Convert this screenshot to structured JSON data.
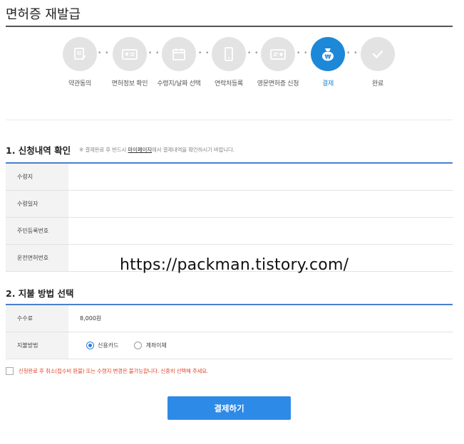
{
  "page": {
    "title": "면허증 재발급"
  },
  "steps": [
    {
      "label": "약관동의",
      "icon": "document-pen-icon",
      "active": false
    },
    {
      "label": "면허정보 확인",
      "icon": "id-card-icon",
      "active": false
    },
    {
      "label": "수령지/날짜 선택",
      "icon": "calendar-icon",
      "active": false
    },
    {
      "label": "연락처등록",
      "icon": "phone-icon",
      "active": false
    },
    {
      "label": "영문면허증 신청",
      "icon": "license-card-icon",
      "active": false
    },
    {
      "label": "결제",
      "icon": "money-bag-icon",
      "active": true
    },
    {
      "label": "완료",
      "icon": "check-icon",
      "active": false
    }
  ],
  "section1": {
    "title": "1. 신청내역 확인",
    "note_prefix": "※ 결제완료 후 반드시 ",
    "note_link": "마이페이지",
    "note_suffix": "에서 결제내역을 확인하시기 바랍니다.",
    "rows": [
      {
        "label": "수령지",
        "value": ""
      },
      {
        "label": "수령일자",
        "value": ""
      },
      {
        "label": "주민등록번호",
        "value": ""
      },
      {
        "label": "운전면허번호",
        "value": ""
      }
    ]
  },
  "section2": {
    "title": "2. 지불 방법 선택",
    "fee_label": "수수료",
    "fee_value": "8,000원",
    "method_label": "지불방법",
    "methods": [
      {
        "label": "신용카드",
        "checked": true
      },
      {
        "label": "계좌이체",
        "checked": false
      }
    ]
  },
  "agree": {
    "text": "신청완료 후 취소(접수비 환불) 또는 수령지 변경은 불가능합니다. 신중히 선택해 주세요."
  },
  "pay_button": {
    "label": "결제하기"
  },
  "watermark": {
    "text": "https://packman.tistory.com/"
  },
  "colors": {
    "accent": "#1e88d8",
    "button": "#2d8ae6",
    "warning": "#e04a2a"
  }
}
